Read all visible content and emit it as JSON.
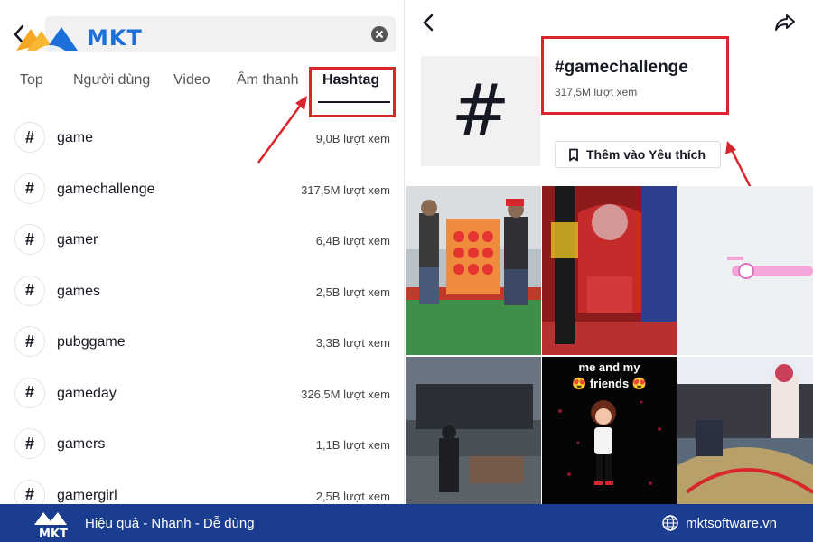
{
  "brand": {
    "name": "MKT",
    "slogan": "Hiệu quả - Nhanh - Dễ dùng",
    "website": "mktsoftware.vn",
    "colors": {
      "primary": "#1c6fd8",
      "accent": "#f5a623",
      "footer": "#1a3d8f",
      "highlight": "#d8262d"
    }
  },
  "search": {
    "value": ""
  },
  "tabs": [
    {
      "label": "Top"
    },
    {
      "label": "Người dùng"
    },
    {
      "label": "Video"
    },
    {
      "label": "Âm thanh"
    },
    {
      "label": "Hashtag",
      "active": true
    }
  ],
  "hashtags": [
    {
      "symbol": "#",
      "name": "game",
      "views": "9,0B lượt xem"
    },
    {
      "symbol": "#",
      "name": "gamechallenge",
      "views": "317,5M lượt xem"
    },
    {
      "symbol": "#",
      "name": "gamer",
      "views": "6,4B lượt xem"
    },
    {
      "symbol": "#",
      "name": "games",
      "views": "2,5B lượt xem"
    },
    {
      "symbol": "#",
      "name": "pubggame",
      "views": "3,3B lượt xem"
    },
    {
      "symbol": "#",
      "name": "gameday",
      "views": "326,5M lượt xem"
    },
    {
      "symbol": "#",
      "name": "gamers",
      "views": "1,1B lượt xem"
    },
    {
      "symbol": "#",
      "name": "gamergirl",
      "views": "2,5B lượt xem"
    }
  ],
  "detail": {
    "symbol": "#",
    "title": "#gamechallenge",
    "views": "317,5M lượt xem",
    "favorite_label": "Thêm vào Yêu thích",
    "video_captions": [
      "me and my",
      "friends"
    ]
  }
}
